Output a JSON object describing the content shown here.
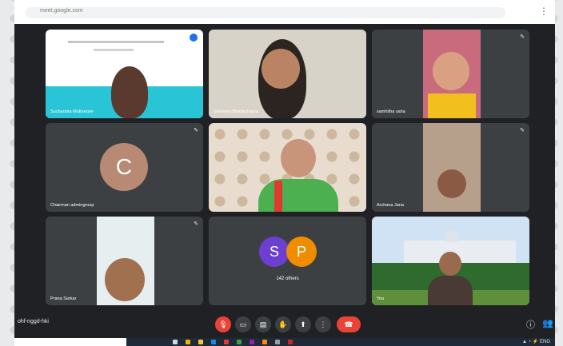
{
  "browser": {
    "url": "meet.google.com"
  },
  "tiles": [
    {
      "name": "Suchandra Mukherjee"
    },
    {
      "name": "Sreemita Bhattacharya"
    },
    {
      "name": "samhitha saha"
    },
    {
      "name": "Chairman admingroup",
      "initial": "C"
    },
    {
      "name": ""
    },
    {
      "name": "Archana Jana"
    },
    {
      "name": "Prana Sarkar"
    },
    {
      "name": "142 others",
      "initials": [
        "S",
        "P"
      ]
    },
    {
      "name": "You"
    }
  ],
  "bottom": {
    "meeting_code": "ohf-nggd-hki"
  },
  "colors": {
    "avatar_c": "#b88a73",
    "avatar_s": "#6c3fd1",
    "avatar_p": "#f08c00",
    "end_call": "#ea4335"
  }
}
